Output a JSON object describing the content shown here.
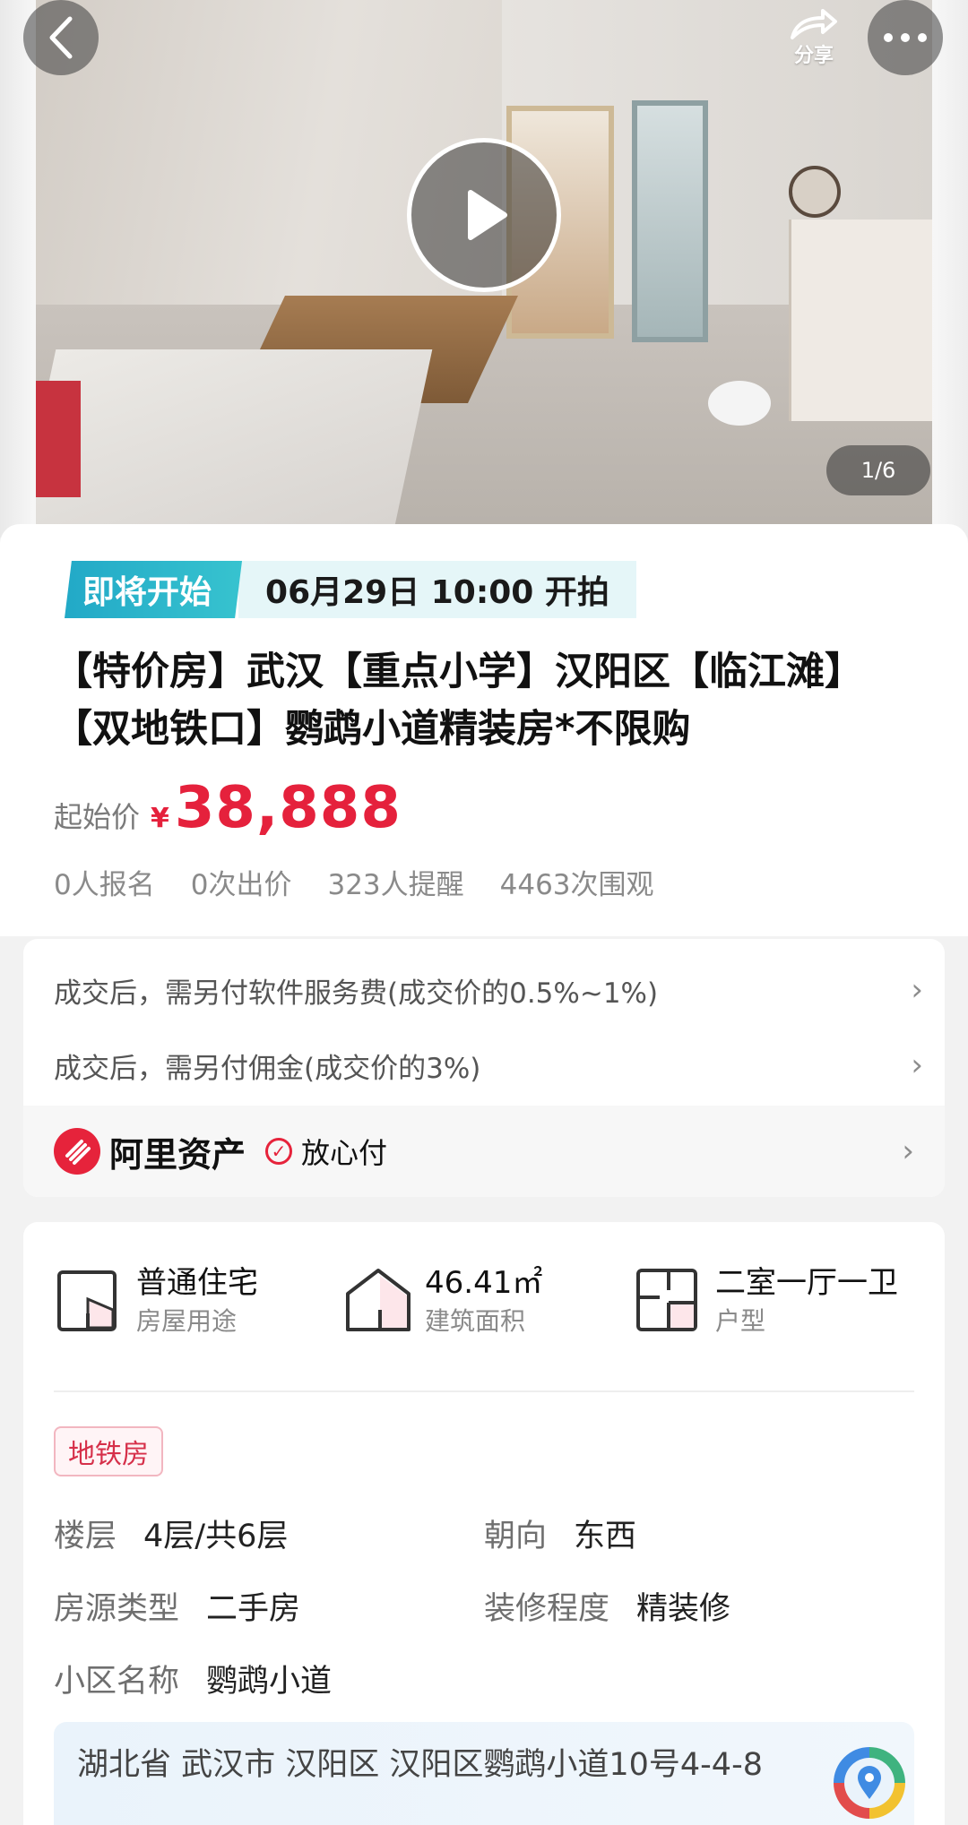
{
  "hero": {
    "photo_counter": "1/6",
    "share_label": "分享"
  },
  "auction": {
    "status_badge": "即将开始",
    "start_time": "06月29日 10:00 开拍",
    "title": "【特价房】武汉【重点小学】汉阳区【临江滩】【双地铁口】鹦鹉小道精装房*不限购",
    "price_label": "起始价",
    "currency_symbol": "¥",
    "starting_price": "38,888",
    "stats": {
      "registered": "0人报名",
      "bids": "0次出价",
      "reminders": "323人提醒",
      "views": "4463次围观"
    }
  },
  "fees": {
    "service_fee": "成交后，需另付软件服务费(成交价的0.5%~1%)",
    "commission": "成交后，需另付佣金(成交价的3%)",
    "platform_brand": "阿里资产",
    "safe_pay": "放心付"
  },
  "specs": {
    "usage": {
      "value": "普通住宅",
      "label": "房屋用途"
    },
    "area": {
      "value": "46.41㎡",
      "label": "建筑面积"
    },
    "layout": {
      "value": "二室一厅一卫",
      "label": "户型"
    }
  },
  "tag": "地铁房",
  "attributes": {
    "floor": {
      "key": "楼层",
      "value": "4层/共6层"
    },
    "orientation": {
      "key": "朝向",
      "value": "东西"
    },
    "source_type": {
      "key": "房源类型",
      "value": "二手房"
    },
    "decoration": {
      "key": "装修程度",
      "value": "精装修"
    },
    "community": {
      "key": "小区名称",
      "value": "鹦鹉小道"
    }
  },
  "address": "湖北省 武汉市 汉阳区 汉阳区鹦鹉小道10号4-4-8",
  "colors": {
    "accent_red": "#e5213c",
    "status_teal": "#22a9c7"
  }
}
